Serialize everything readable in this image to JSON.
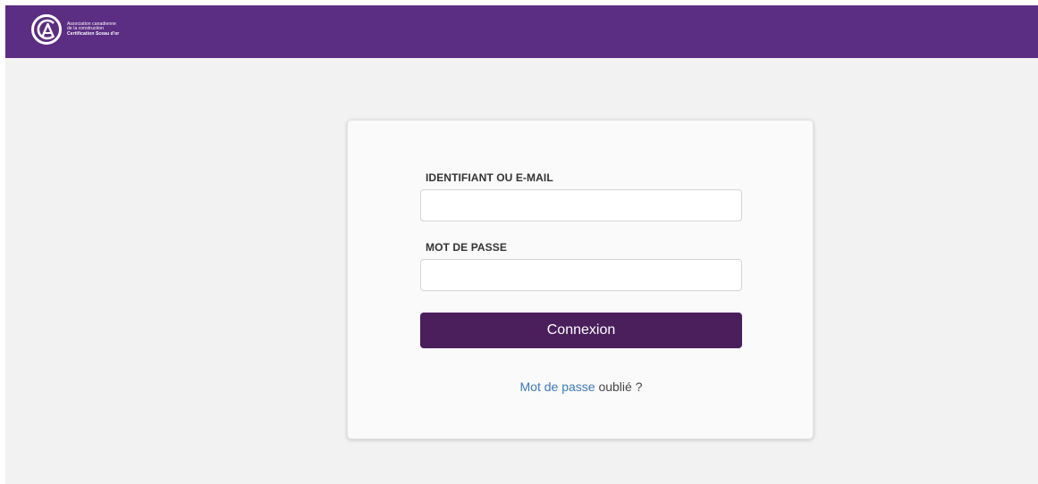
{
  "header": {
    "logo": {
      "icon": "caca-logo-icon",
      "line1": "Association canadienne",
      "line2": "de la construction",
      "line3": "Certification Sceau d'or"
    },
    "brand_color": "#5b2d83"
  },
  "login": {
    "username_label": "IDENTIFIANT OU E-MAIL",
    "username_value": "",
    "password_label": "MOT DE PASSE",
    "password_value": "",
    "submit_label": "Connexion",
    "submit_color": "#4a1f5c",
    "forgot_link": "Mot de passe",
    "forgot_suffix": " oublié ?",
    "link_color": "#3a7ab8"
  }
}
